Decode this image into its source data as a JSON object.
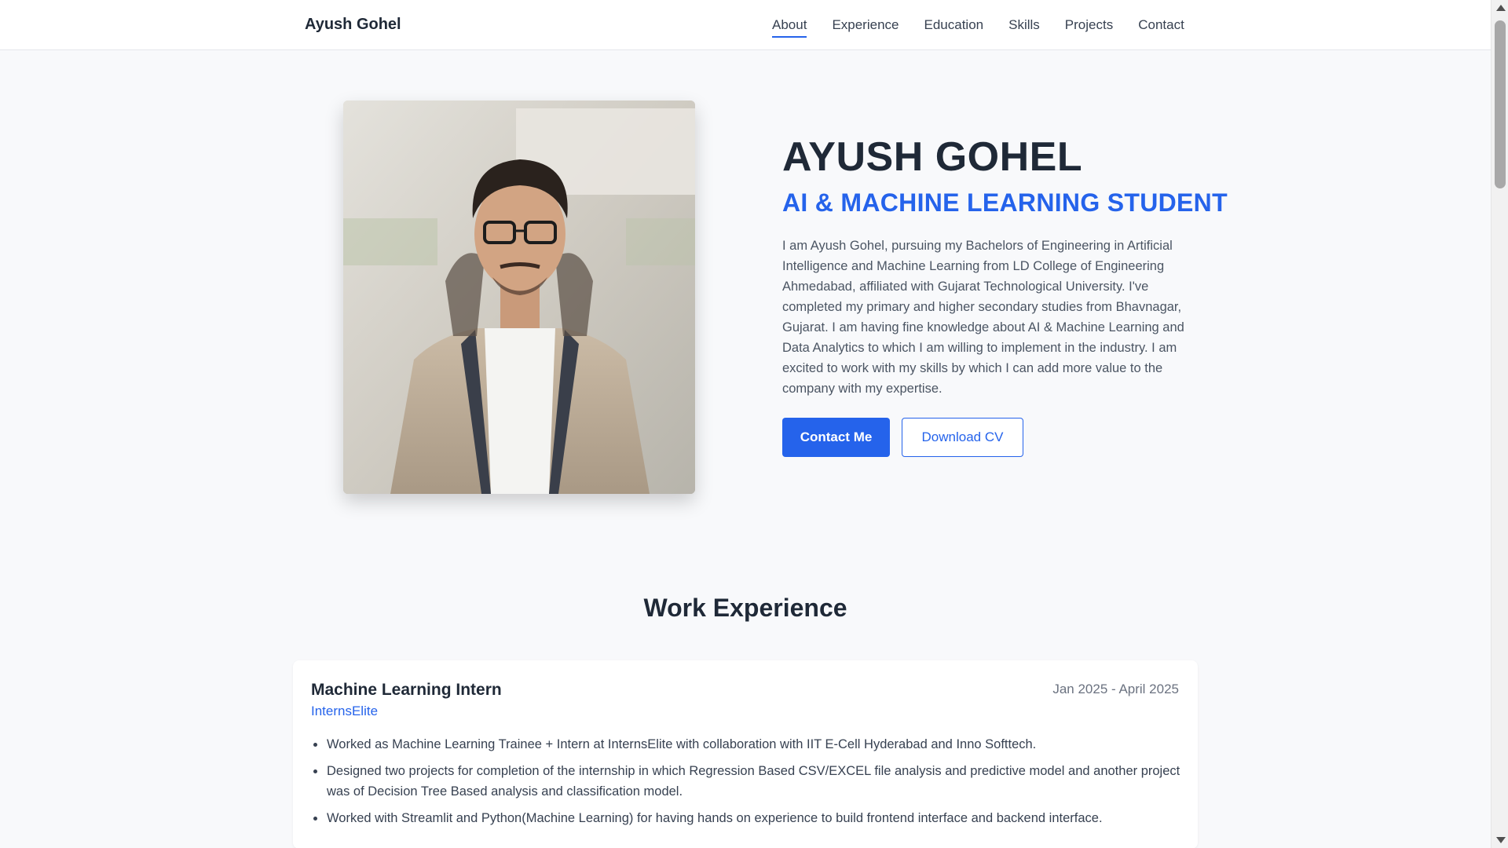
{
  "nav": {
    "brand": "Ayush Gohel",
    "links": [
      "About",
      "Experience",
      "Education",
      "Skills",
      "Projects",
      "Contact"
    ],
    "active": "About"
  },
  "hero": {
    "photo_alt": "Portrait photo",
    "name": "AYUSH GOHEL",
    "role": "AI & MACHINE LEARNING STUDENT",
    "bio": "I am Ayush Gohel, pursuing my Bachelors of Engineering in Artificial Intelligence and Machine Learning from LD College of Engineering Ahmedabad, affiliated with Gujarat Technological University. I've completed my primary and higher secondary studies from Bhavnagar, Gujarat. I am having fine knowledge about AI & Machine Learning and Data Analytics to which I am willing to implement in the industry. I am excited to work with my skills by which I can add more value to the company with my expertise.",
    "contact_button": "Contact Me",
    "cv_button": "Download CV"
  },
  "experience": {
    "title": "Work Experience",
    "items": [
      {
        "role": "Machine Learning Intern",
        "company": "InternsElite",
        "dates": "Jan 2025 - April 2025",
        "bullets": [
          "Worked as Machine Learning Trainee + Intern at InternsElite with collaboration with IIT E-Cell Hyderabad and Inno Softtech.",
          "Designed two projects for completion of the internship in which Regression Based CSV/EXCEL file analysis and predictive model and another project was of Decision Tree Based analysis and classification model.",
          "Worked with Streamlit and Python(Machine Learning) for having hands on experience to build frontend interface and backend interface."
        ]
      }
    ]
  },
  "colors": {
    "accent": "#2563eb",
    "text": "#1f2937",
    "background": "#f8f9fb"
  }
}
